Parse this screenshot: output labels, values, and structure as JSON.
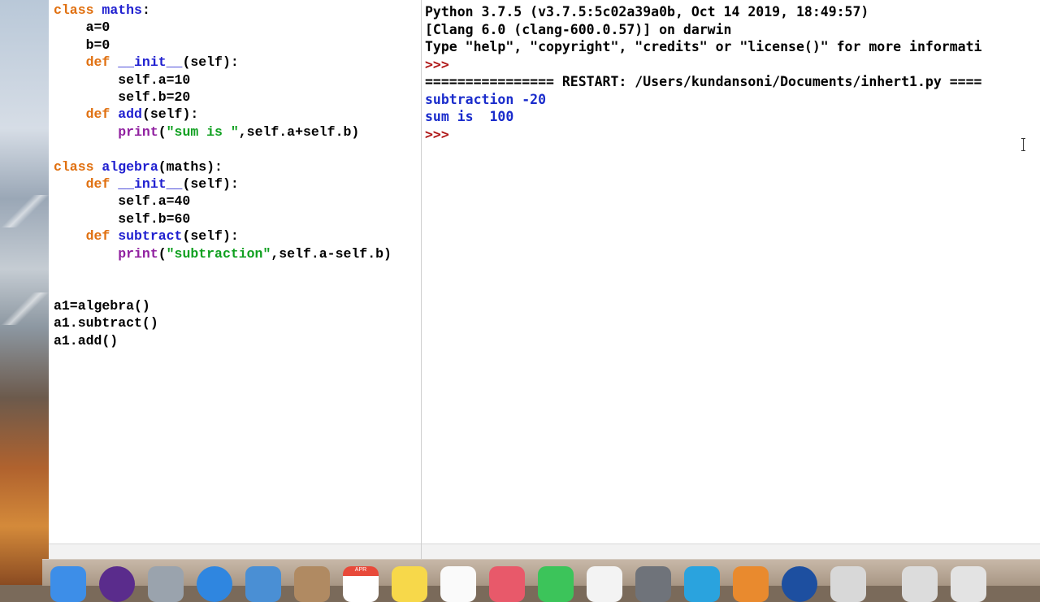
{
  "editor": {
    "lines": [
      [
        "kw:class ",
        "def-name:maths",
        "plain::"
      ],
      [
        "plain:    a=0"
      ],
      [
        "plain:    b=0"
      ],
      [
        "plain:    ",
        "kw:def ",
        "def-name:__init__",
        "plain:(self):"
      ],
      [
        "plain:        self.a=10"
      ],
      [
        "plain:        self.b=20"
      ],
      [
        "plain:    ",
        "kw:def ",
        "def-name:add",
        "plain:(self):"
      ],
      [
        "plain:        ",
        "builtin:print",
        "plain:(",
        "str:\"sum is \"",
        "plain:,self.a+self.b)"
      ],
      [
        "plain:"
      ],
      [
        "kw:class ",
        "def-name:algebra",
        "plain:(maths):"
      ],
      [
        "plain:    ",
        "kw:def ",
        "def-name:__init__",
        "plain:(self):"
      ],
      [
        "plain:        self.a=40"
      ],
      [
        "plain:        self.b=60"
      ],
      [
        "plain:    ",
        "kw:def ",
        "def-name:subtract",
        "plain:(self):"
      ],
      [
        "plain:        ",
        "builtin:print",
        "plain:(",
        "str:\"subtraction\"",
        "plain:,self.a-self.b)"
      ],
      [
        "plain:"
      ],
      [
        "plain:"
      ],
      [
        "plain:a1=algebra()"
      ],
      [
        "plain:a1.subtract()"
      ],
      [
        "plain:a1.add()"
      ]
    ]
  },
  "shell": {
    "lines": [
      [
        "plain:Python 3.7.5 (v3.7.5:5c02a39a0b, Oct 14 2019, 18:49:57)"
      ],
      [
        "plain:[Clang 6.0 (clang-600.0.57)] on darwin"
      ],
      [
        "plain:Type \"help\", \"copyright\", \"credits\" or \"license()\" for more informati"
      ],
      [
        "prompt:>>> "
      ],
      [
        "plain:================ RESTART: /Users/kundansoni/Documents/inhert1.py ===="
      ],
      [
        "out:subtraction -20"
      ],
      [
        "out:sum is  100"
      ],
      [
        "prompt:>>> "
      ]
    ]
  },
  "dock": {
    "calendar_month": "APR",
    "items": [
      {
        "name": "finder-icon",
        "color": "#3d8ee8"
      },
      {
        "name": "siri-icon",
        "color": "#5a2c8c"
      },
      {
        "name": "launchpad-icon",
        "color": "#9aa3ad"
      },
      {
        "name": "safari-icon",
        "color": "#2f86e0"
      },
      {
        "name": "mail-icon",
        "color": "#4a8fd4"
      },
      {
        "name": "contacts-icon",
        "color": "#b08a62"
      },
      {
        "name": "calendar-icon",
        "color": "#ffffff"
      },
      {
        "name": "notes-icon",
        "color": "#f7d84a"
      },
      {
        "name": "reminders-icon",
        "color": "#fafafa"
      },
      {
        "name": "photos-icon",
        "color": "#e8596a"
      },
      {
        "name": "facetime-icon",
        "color": "#3cc45a"
      },
      {
        "name": "itunes-icon",
        "color": "#f3f3f3"
      },
      {
        "name": "system-preferences-icon",
        "color": "#6f737a"
      },
      {
        "name": "telegram-icon",
        "color": "#2aa3de"
      },
      {
        "name": "pages-icon",
        "color": "#e98a2e"
      },
      {
        "name": "quicktime-icon",
        "color": "#1d4fa0"
      },
      {
        "name": "python-launcher-icon",
        "color": "#d8d8d8"
      },
      {
        "name": "window-thumbnail-icon",
        "color": "#dcdcdc"
      },
      {
        "name": "trash-icon",
        "color": "#e3e3e3"
      }
    ]
  }
}
